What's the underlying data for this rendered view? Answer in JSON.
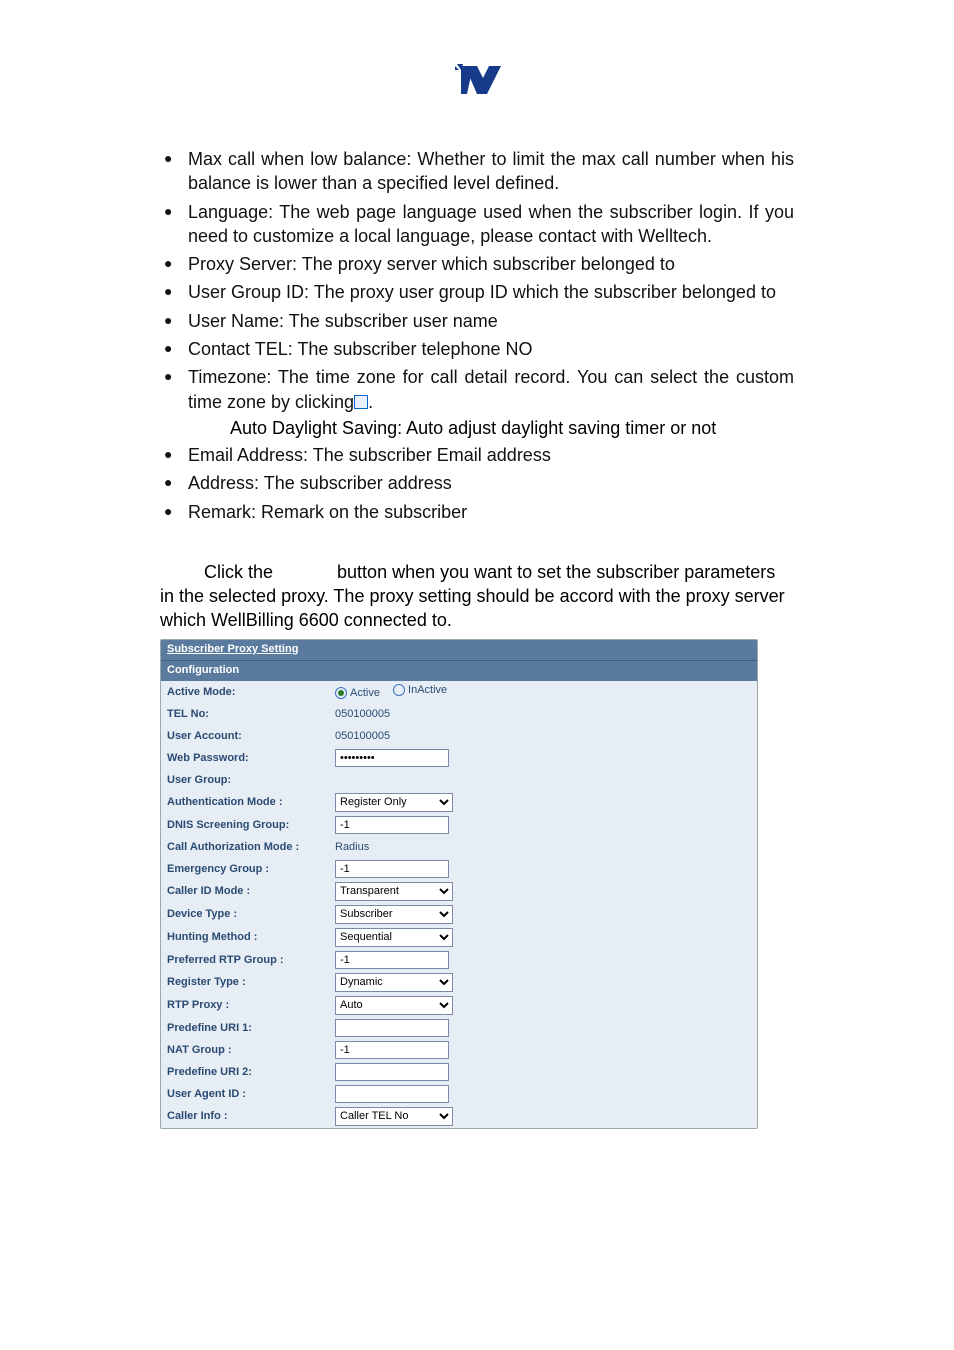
{
  "doc": {
    "bullets": [
      "Max call when low balance: Whether to limit the max call number when his balance is lower than a specified level defined.",
      "Language: The web page language used when the subscriber login. If you need to customize a local language, please contact with Welltech.",
      "Proxy Server: The proxy server which subscriber belonged to",
      "User Group ID: The proxy user group ID which the subscriber belonged to",
      "User Name: The subscriber user name",
      "Contact TEL: The subscriber telephone NO",
      "Timezone: The time zone for call detail record. You can select the custom time zone by clicking",
      "Email Address: The subscriber Email address",
      "Address: The subscriber address",
      "Remark: Remark on the subscriber"
    ],
    "timezone_suffix": ".",
    "auto_dst_note": "Auto Daylight Saving: Auto adjust daylight saving timer or not",
    "para_prefix": "Click the",
    "para_suffix": "button when you want to set the subscriber parameters in the selected proxy. The proxy setting should be accord with the proxy server which WellBilling 6600 connected to."
  },
  "panel": {
    "title": "Subscriber Proxy Setting",
    "section": "Configuration",
    "active_mode_label": "Active Mode:",
    "active_label": "Active",
    "inactive_label": "InActive",
    "rows": {
      "tel_no_label": "TEL No:",
      "tel_no_value": "050100005",
      "user_account_label": "User Account:",
      "user_account_value": "050100005",
      "web_password_label": "Web Password:",
      "web_password_value": "•••••••••",
      "user_group_label": "User Group:",
      "auth_mode_label": "Authentication Mode :",
      "auth_mode_value": "Register Only",
      "dnis_label": "DNIS Screening Group:",
      "dnis_value": "-1",
      "call_auth_label": "Call Authorization Mode :",
      "call_auth_value": "Radius",
      "emergency_label": "Emergency Group :",
      "emergency_value": "-1",
      "callerid_label": "Caller ID Mode :",
      "callerid_value": "Transparent",
      "device_label": "Device Type :",
      "device_value": "Subscriber",
      "hunting_label": "Hunting Method :",
      "hunting_value": "Sequential",
      "rtpgrp_label": "Preferred RTP Group :",
      "rtpgrp_value": "-1",
      "regtype_label": "Register Type :",
      "regtype_value": "Dynamic",
      "rtpproxy_label": "RTP Proxy :",
      "rtpproxy_value": "Auto",
      "predef1_label": "Predefine URI 1:",
      "predef1_value": "",
      "natgrp_label": "NAT Group :",
      "natgrp_value": "-1",
      "predef2_label": "Predefine URI 2:",
      "predef2_value": "",
      "uaid_label": "User Agent ID :",
      "uaid_value": "",
      "callerinfo_label": "Caller Info :",
      "callerinfo_value": "Caller TEL No"
    }
  }
}
